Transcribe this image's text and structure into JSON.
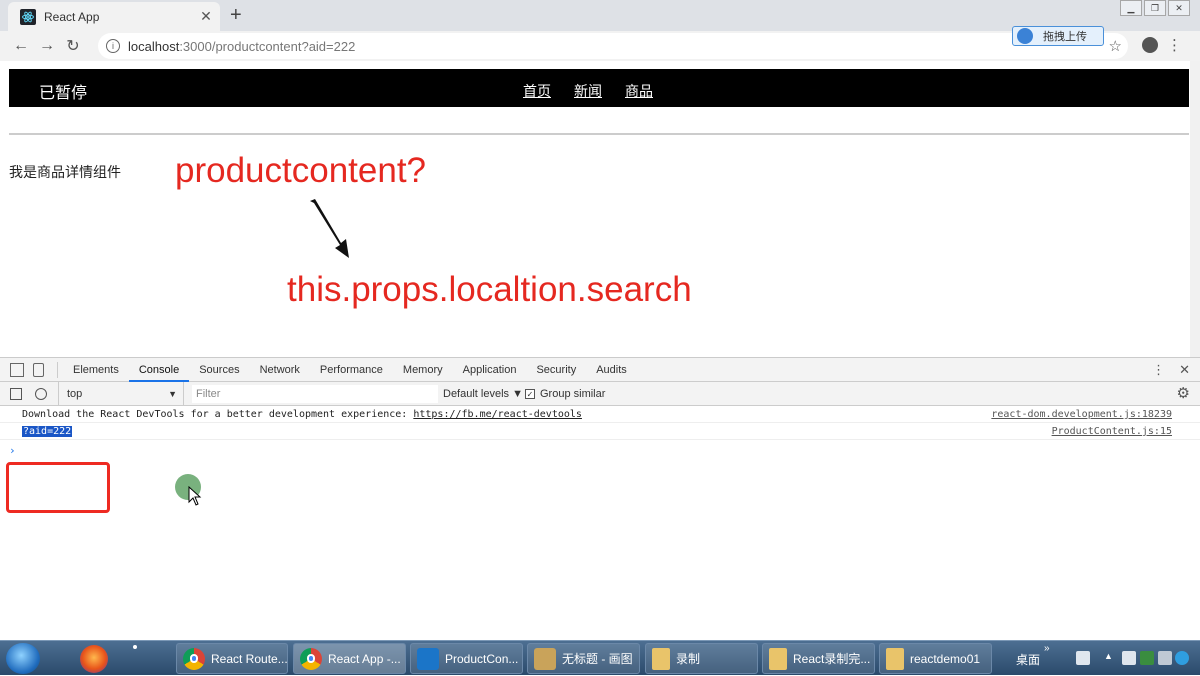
{
  "browser": {
    "tab_title": "React App",
    "tab_close": "✕",
    "new_tab": "+",
    "url_host": "localhost",
    "url_rest": ":3000/productcontent?aid=222",
    "upload_label": "拖拽上传"
  },
  "page": {
    "brand": "已暂停",
    "nav": [
      "首页",
      "新闻",
      "商品"
    ],
    "content_text": "我是商品详情组件",
    "annotation_top": "productcontent?",
    "annotation_bottom": "this.props.localtion.search"
  },
  "devtools": {
    "tabs": [
      "Elements",
      "Console",
      "Sources",
      "Network",
      "Performance",
      "Memory",
      "Application",
      "Security",
      "Audits"
    ],
    "active_tab": "Console",
    "context": "top",
    "filter_placeholder": "Filter",
    "levels": "Default levels ▼",
    "group_similar": "Group similar",
    "console_lines": [
      {
        "text": "Download the React DevTools for a better development experience: ",
        "link": "https://fb.me/react-devtools",
        "source": "react-dom.development.js:18239"
      },
      {
        "text": "?aid=222",
        "source": "ProductContent.js:15"
      }
    ],
    "prompt": "›"
  },
  "taskbar": {
    "items": [
      {
        "label": "React Route...",
        "icon": "chrome-icon"
      },
      {
        "label": "React App -...",
        "icon": "chrome-icon"
      },
      {
        "label": "ProductCon...",
        "icon": "vscode-icon"
      },
      {
        "label": "无标题 - 画图",
        "icon": "paint-icon"
      },
      {
        "label": "录制",
        "icon": "folder-icon"
      },
      {
        "label": "React录制完...",
        "icon": "folder-icon"
      },
      {
        "label": "reactdemo01",
        "icon": "folder-icon"
      }
    ],
    "desktop_label": "桌面"
  },
  "colors": {
    "annotation": "#e52820",
    "highlight_box": "#ee2a22",
    "selection": "#1a56c6"
  }
}
